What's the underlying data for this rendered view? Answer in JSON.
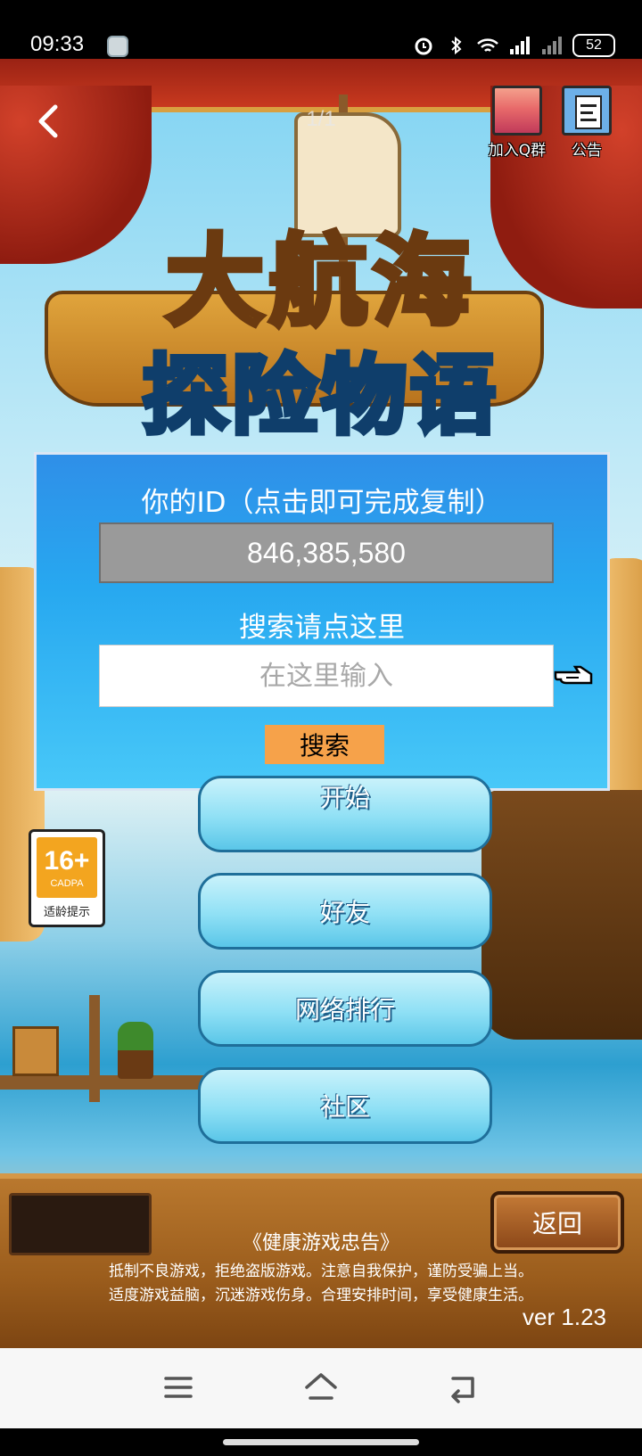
{
  "status_bar": {
    "time": "09:33",
    "battery": "52",
    "icons": [
      "alarm-icon",
      "bluetooth-icon",
      "wifi-icon",
      "signal-icon",
      "signal-icon",
      "battery-icon"
    ]
  },
  "header": {
    "page_indicator": "1/1",
    "qq_group_label": "加入Q群",
    "notice_label": "公告"
  },
  "logo": {
    "line1": "大航海",
    "line2": "探险物语"
  },
  "id_panel": {
    "title": "你的ID（点击即可完成复制）",
    "id_value": "846,385,580",
    "search_title": "搜索请点这里",
    "search_placeholder": "在这里输入",
    "search_button": "搜索"
  },
  "menu": {
    "items": [
      {
        "label": "开始"
      },
      {
        "label": "好友"
      },
      {
        "label": "网络排行"
      },
      {
        "label": "社区"
      }
    ]
  },
  "age_badge": {
    "rating": "16+",
    "org": "CADPA",
    "label": "适龄提示"
  },
  "bottom": {
    "return_button": "返回",
    "health_title": "《健康游戏忠告》",
    "health_line1": "抵制不良游戏，拒绝盗版游戏。注意自我保护，谨防受骗上当。",
    "health_line2": "适度游戏益脑，沉迷游戏伤身。合理安排时间，享受健康生活。",
    "version": "ver 1.23"
  },
  "colors": {
    "panel_blue": "#2f8fe8",
    "search_button": "#f6a24a",
    "id_field": "#9a9a9a",
    "wood": "#9a5c1c"
  }
}
